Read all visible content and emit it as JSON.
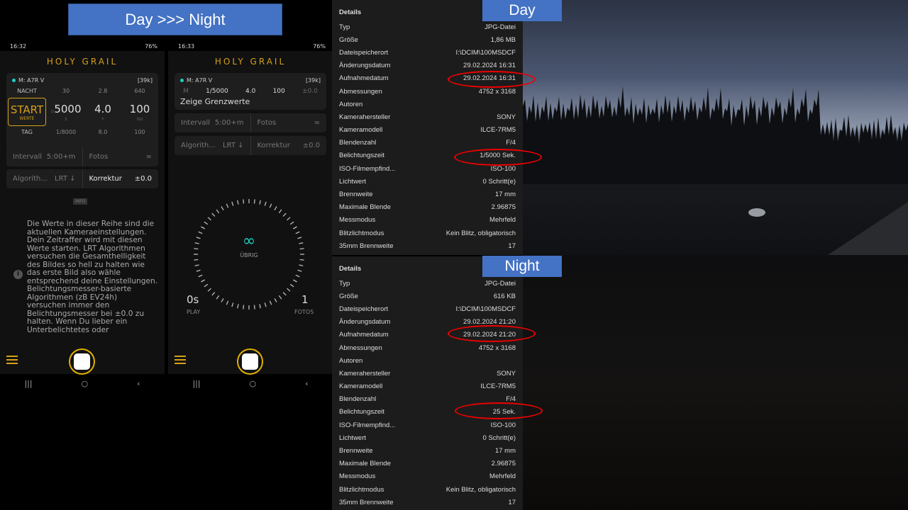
{
  "banner": "Day >>> Night",
  "phones": [
    {
      "time": "16:32",
      "battery": "76%",
      "title": "HOLY GRAIL",
      "camera": "M: A7R V",
      "buffer": "[39k]",
      "rows": {
        "night": {
          "label": "NACHT",
          "s": "30",
          "f": "2.8",
          "iso": "640"
        },
        "current": {
          "start": "START",
          "start_sub": "WERTE",
          "s_prefix": "1/",
          "s": "5000",
          "s_unit": "S",
          "f": "4.0",
          "f_unit": "F",
          "iso": "100",
          "iso_unit": "ISO"
        },
        "day": {
          "label": "TAG",
          "s": "1/8000",
          "f": "8.0",
          "iso": "100"
        }
      },
      "interval_label": "Intervall",
      "interval": "5:00+m",
      "fotos_label": "Fotos",
      "fotos": "∞",
      "algo_label": "Algorith...",
      "algo": "LRT ↓",
      "korr_label": "Korrektur",
      "korr": "±0.0",
      "info_badge": "INFO",
      "info_text": "Die Werte in dieser Reihe sind die aktuellen Kameraeinstellungen. Dein Zeitraffer wird mit diesen Werte starten. LRT Algorithmen versuchen die Gesamthelligkeit des Bildes so hell zu halten wie das erste Bild also wähle entsprechend deine Einstellungen. Belichtungsmesser-basierte Algorithmen (zB EV24h) versuchen immer den Belichtungsmesser bei ±0.0 zu halten. Wenn Du lieber ein Unterbelichtetes oder"
    },
    {
      "time": "16:33",
      "battery": "76%",
      "title": "HOLY GRAIL",
      "camera": "M: A7R V",
      "buffer": "[39k]",
      "mode": "M",
      "s": "1/5000",
      "f": "4.0",
      "iso": "100",
      "ev": "±0.0",
      "limits": "Zeige Grenzwerte",
      "interval_label": "Intervall",
      "interval": "5:00+m",
      "fotos_label": "Fotos",
      "fotos": "∞",
      "algo_label": "Algorith...",
      "algo": "LRT ↓",
      "korr_label": "Korrektur",
      "korr": "±0.0",
      "remaining": "∞",
      "remaining_label": "ÜBRIG",
      "play": "0s",
      "play_label": "PLAY",
      "photos": "1",
      "photos_label": "FOTOS"
    }
  ],
  "details": [
    {
      "tag": "Day",
      "heading": "Details",
      "rows": [
        [
          "Typ",
          "JPG-Datei"
        ],
        [
          "Größe",
          "1,86 MB"
        ],
        [
          "Dateispeicherort",
          "I:\\DCIM\\100MSDCF"
        ],
        [
          "Änderungsdatum",
          "29.02.2024 16:31"
        ],
        [
          "Aufnahmedatum",
          "29.02.2024 16:31"
        ],
        [
          "Abmessungen",
          "4752 x 3168"
        ],
        [
          "Autoren",
          ""
        ],
        [
          "Kamerahersteller",
          "SONY"
        ],
        [
          "Kameramodell",
          "ILCE-7RM5"
        ],
        [
          "Blendenzahl",
          "F/4"
        ],
        [
          "Belichtungszeit",
          "1/5000 Sek."
        ],
        [
          "ISO-Filmempfind...",
          "ISO-100"
        ],
        [
          "Lichtwert",
          "0 Schritt(e)"
        ],
        [
          "Brennweite",
          "17 mm"
        ],
        [
          "Maximale Blende",
          "2.96875"
        ],
        [
          "Messmodus",
          "Mehrfeld"
        ],
        [
          "Blitzlichtmodus",
          "Kein Blitz, obligatorisch"
        ],
        [
          "35mm Brennweite",
          "17"
        ]
      ]
    },
    {
      "tag": "Night",
      "heading": "Details",
      "rows": [
        [
          "Typ",
          "JPG-Datei"
        ],
        [
          "Größe",
          "616 KB"
        ],
        [
          "Dateispeicherort",
          "I:\\DCIM\\100MSDCF"
        ],
        [
          "Änderungsdatum",
          "29.02.2024 21:20"
        ],
        [
          "Aufnahmedatum",
          "29.02.2024 21:20"
        ],
        [
          "Abmessungen",
          "4752 x 3168"
        ],
        [
          "Autoren",
          ""
        ],
        [
          "Kamerahersteller",
          "SONY"
        ],
        [
          "Kameramodell",
          "ILCE-7RM5"
        ],
        [
          "Blendenzahl",
          "F/4"
        ],
        [
          "Belichtungszeit",
          "25 Sek."
        ],
        [
          "ISO-Filmempfind...",
          "ISO-100"
        ],
        [
          "Lichtwert",
          "0 Schritt(e)"
        ],
        [
          "Brennweite",
          "17 mm"
        ],
        [
          "Maximale Blende",
          "2.96875"
        ],
        [
          "Messmodus",
          "Mehrfeld"
        ],
        [
          "Blitzlichtmodus",
          "Kein Blitz, obligatorisch"
        ],
        [
          "35mm Brennweite",
          "17"
        ]
      ]
    }
  ],
  "colors": {
    "accent": "#d4a017",
    "teal": "#1fd1c1",
    "label_blue": "#4472c4",
    "highlight": "#e00000"
  }
}
